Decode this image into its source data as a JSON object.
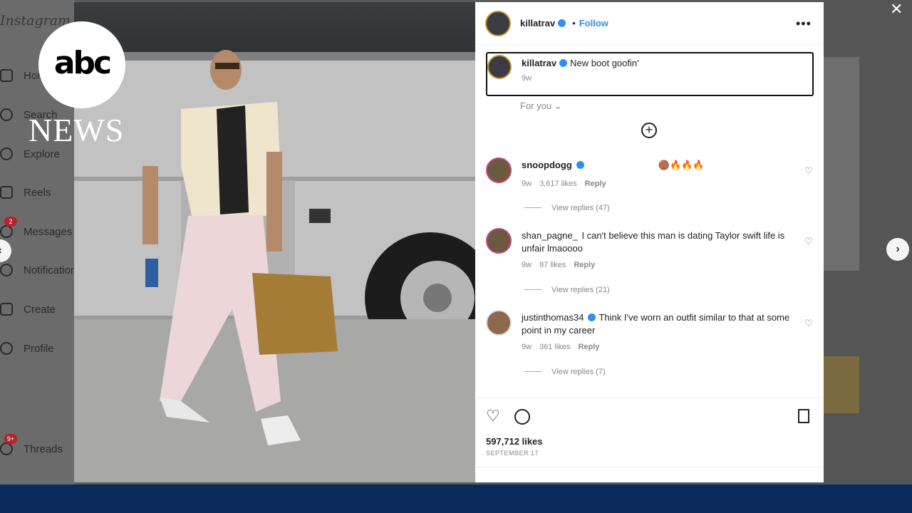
{
  "overlay": {
    "logo_text": "abc",
    "news_text": "NEWS"
  },
  "instagram_bg": {
    "brand": "Instagram",
    "nav": [
      {
        "label": "Home",
        "icon": "home-icon"
      },
      {
        "label": "Search",
        "icon": "search-icon"
      },
      {
        "label": "Explore",
        "icon": "compass-icon"
      },
      {
        "label": "Reels",
        "icon": "reels-icon"
      },
      {
        "label": "Messages",
        "icon": "messenger-icon",
        "badge": "2"
      },
      {
        "label": "Notifications",
        "icon": "heart-icon"
      },
      {
        "label": "Create",
        "icon": "plus-square-icon"
      },
      {
        "label": "Profile",
        "icon": "avatar-icon"
      },
      {
        "label": "Threads",
        "icon": "threads-icon",
        "badge": "9+"
      }
    ],
    "close_symbol": "✕",
    "prev_symbol": "‹",
    "next_symbol": "›"
  },
  "post": {
    "author": "killatrav",
    "follow_label": "Follow",
    "more_symbol": "•••",
    "caption": {
      "user": "killatrav",
      "text": "New boot goofin'",
      "time": "9w"
    },
    "sort_label": "For you ⌄",
    "load_more_symbol": "+",
    "comments": [
      {
        "user": "snoopdogg",
        "text": "🟤🔥🔥🔥",
        "time": "9w",
        "likes": "3,617 likes",
        "reply": "Reply",
        "replies": "View replies (47)"
      },
      {
        "user": "shan_pagne_",
        "text": "I can't believe this man is dating Taylor swift life is unfair lmaoooo",
        "time": "9w",
        "likes": "87 likes",
        "reply": "Reply",
        "replies": "View replies (21)"
      },
      {
        "user": "justinthomas34",
        "text": "Think I've worn an outfit similar to that at some point in my career",
        "time": "9w",
        "likes": "361 likes",
        "reply": "Reply",
        "replies": "View replies (7)"
      }
    ],
    "likes": "597,712 likes",
    "date": "SEPTEMBER 17"
  },
  "colors": {
    "abc_bar": "#0a2a5c",
    "verified": "#2f8ff0"
  }
}
